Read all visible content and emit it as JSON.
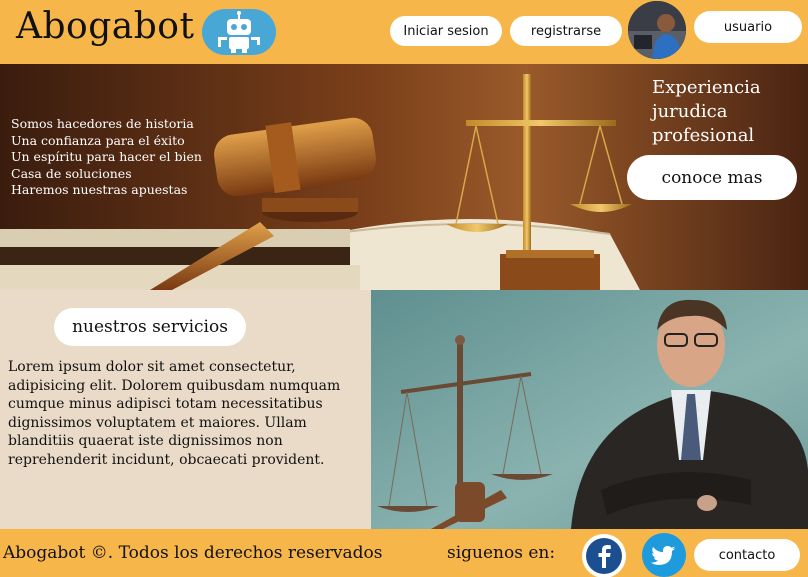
{
  "header": {
    "brand": "Abogabot",
    "login_label": "Iniciar sesion",
    "register_label": "registrarse",
    "user_label": "usuario",
    "logo_icon": "robot-icon",
    "avatar_icon": "user-avatar"
  },
  "hero": {
    "lines": [
      "Somos hacedores de historia",
      "Una confianza para el éxito",
      "Un espíritu para hacer el bien",
      "Casa de soluciones",
      "Haremos nuestras apuestas"
    ],
    "title_lines": [
      "Experiencia",
      "jurudica",
      "profesional"
    ],
    "cta_label": "conoce mas"
  },
  "services": {
    "title": "nuestros servicios",
    "text": "Lorem ipsum dolor sit amet consectetur, adipisicing elit. Dolorem quibusdam numquam cumque minus adipisci totam necessitatibus dignissimos voluptatem et maiores. Ullam blanditiis quaerat iste dignissimos non reprehenderit incidunt, obcaecati provident."
  },
  "footer": {
    "copyright": "Abogabot ©. Todos los derechos reservados",
    "follow": "siguenos en:",
    "contact_label": "contacto",
    "facebook_icon": "facebook-icon",
    "twitter_icon": "twitter-icon"
  },
  "colors": {
    "accent": "#f7b649",
    "logo_bg": "#49a7d6",
    "services_bg": "#eadbc9",
    "facebook": "#1b4f8f",
    "twitter": "#1e9bdc"
  }
}
